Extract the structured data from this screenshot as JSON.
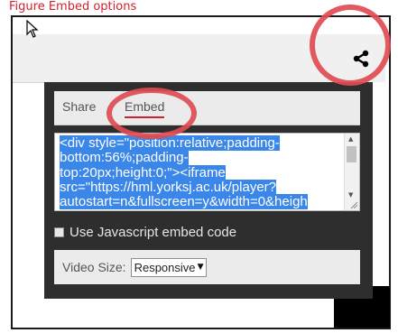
{
  "caption": "Figure  Embed options",
  "toolbar": {
    "share_icon": "share-icon"
  },
  "popup": {
    "tabs": [
      {
        "label": "Share"
      },
      {
        "label": "Embed"
      }
    ],
    "embed_code_lines": [
      "<div style=\"position:relative;padding-",
      "bottom:56%;padding-",
      "top:20px;height:0;\"><iframe",
      "src=\"https://hml.yorksj.ac.uk/player?",
      "autostart=n&fullscreen=y&width=0&heigh"
    ],
    "checkbox_label": "Use Javascript embed code",
    "video_size_label": "Video Size:",
    "video_size_value": "Responsive"
  },
  "colors": {
    "accent": "#d4202e",
    "highlight": "#3b87e9",
    "popup_bg": "#2e2e2e",
    "annotation": "#df4b51"
  }
}
